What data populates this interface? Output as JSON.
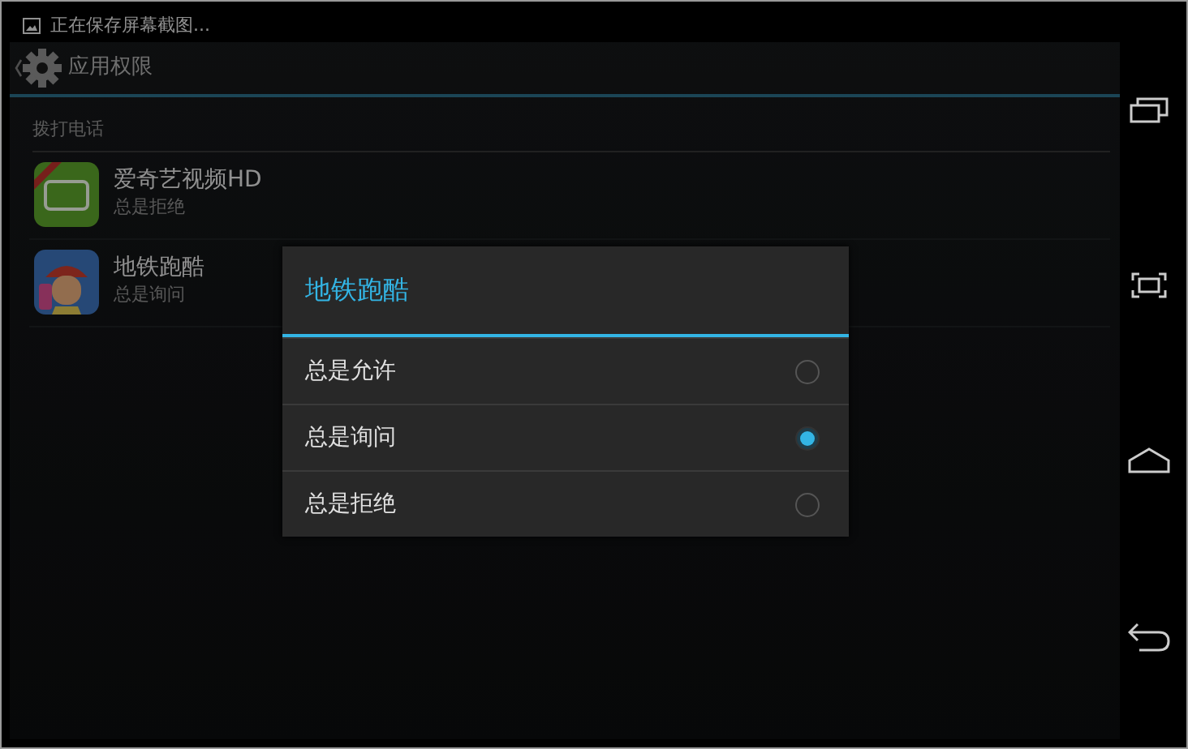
{
  "status_bar": {
    "notification": "正在保存屏幕截图..."
  },
  "action_bar": {
    "title": "应用权限"
  },
  "section": {
    "header": "拨打电话"
  },
  "apps": [
    {
      "name": "爱奇艺视频HD",
      "status": "总是拒绝",
      "kind": "iqiyi"
    },
    {
      "name": "地铁跑酷",
      "status": "总是询问",
      "kind": "game"
    }
  ],
  "dialog": {
    "title": "地铁跑酷",
    "options": [
      {
        "label": "总是允许",
        "selected": false
      },
      {
        "label": "总是询问",
        "selected": true
      },
      {
        "label": "总是拒绝",
        "selected": false
      }
    ]
  },
  "nav_bar": {
    "buttons": [
      {
        "kind": "recent"
      },
      {
        "kind": "screenshot"
      },
      {
        "kind": "home"
      },
      {
        "kind": "back"
      }
    ]
  }
}
